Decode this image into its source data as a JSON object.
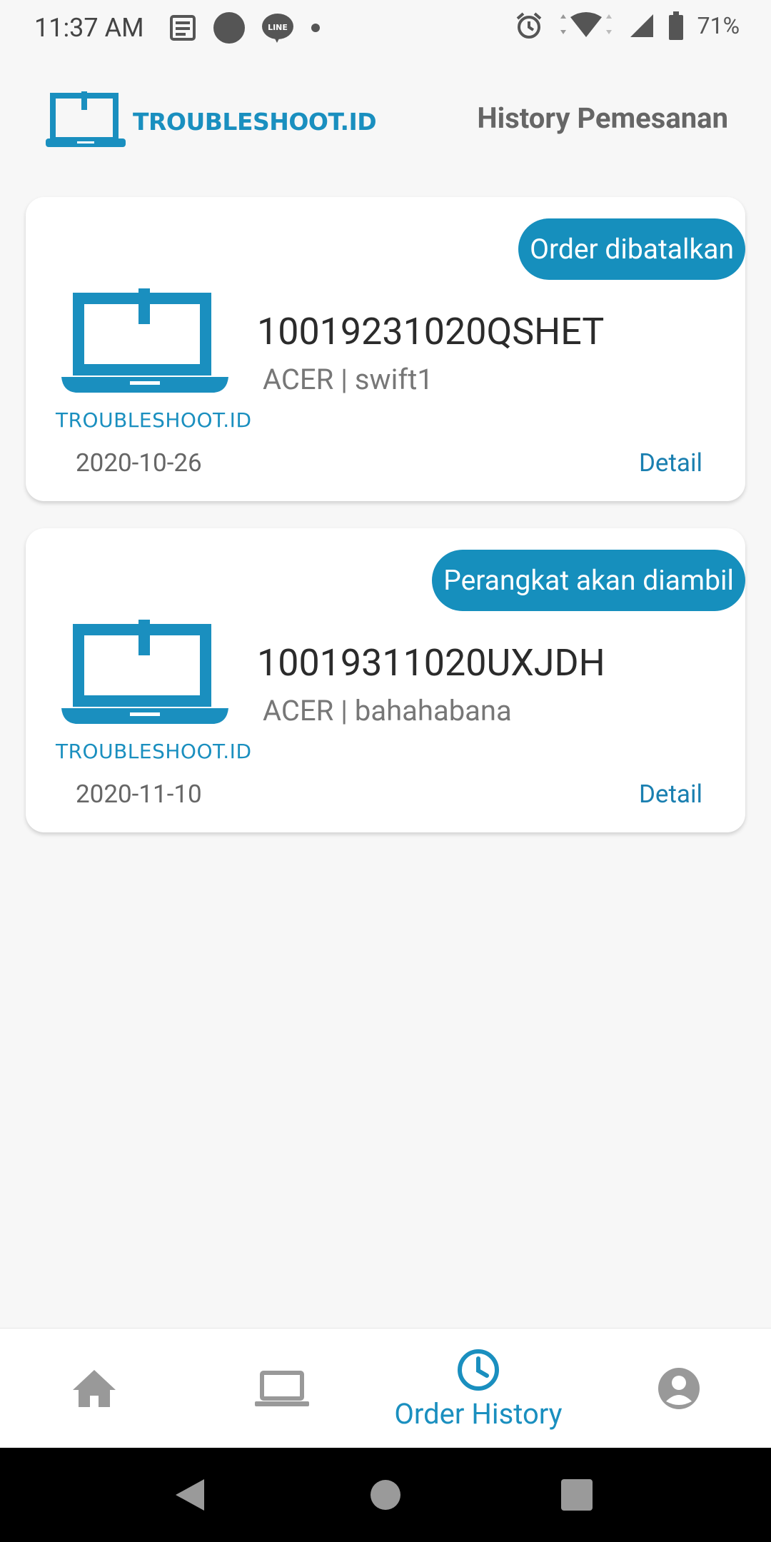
{
  "status_bar": {
    "time": "11:37 AM",
    "battery": "71%"
  },
  "header": {
    "brand": "TROUBLESHOOT.ID",
    "title": "History Pemesanan"
  },
  "orders": [
    {
      "status": "Order dibatalkan",
      "brand": "TROUBLESHOOT.ID",
      "order_id": "10019231020QSHET",
      "device": "ACER | swift1",
      "date": "2020-10-26",
      "detail_label": "Detail"
    },
    {
      "status": "Perangkat akan diambil",
      "brand": "TROUBLESHOOT.ID",
      "order_id": "10019311020UXJDH",
      "device": "ACER | bahahabana",
      "date": "2020-11-10",
      "detail_label": "Detail"
    }
  ],
  "bottom_nav": {
    "items": [
      {
        "icon": "home-icon"
      },
      {
        "icon": "laptop-icon"
      },
      {
        "icon": "clock-icon",
        "label": "Order History",
        "active": true
      },
      {
        "icon": "account-icon"
      }
    ]
  },
  "colors": {
    "accent": "#1a8fbf",
    "pill": "#168fbd"
  }
}
